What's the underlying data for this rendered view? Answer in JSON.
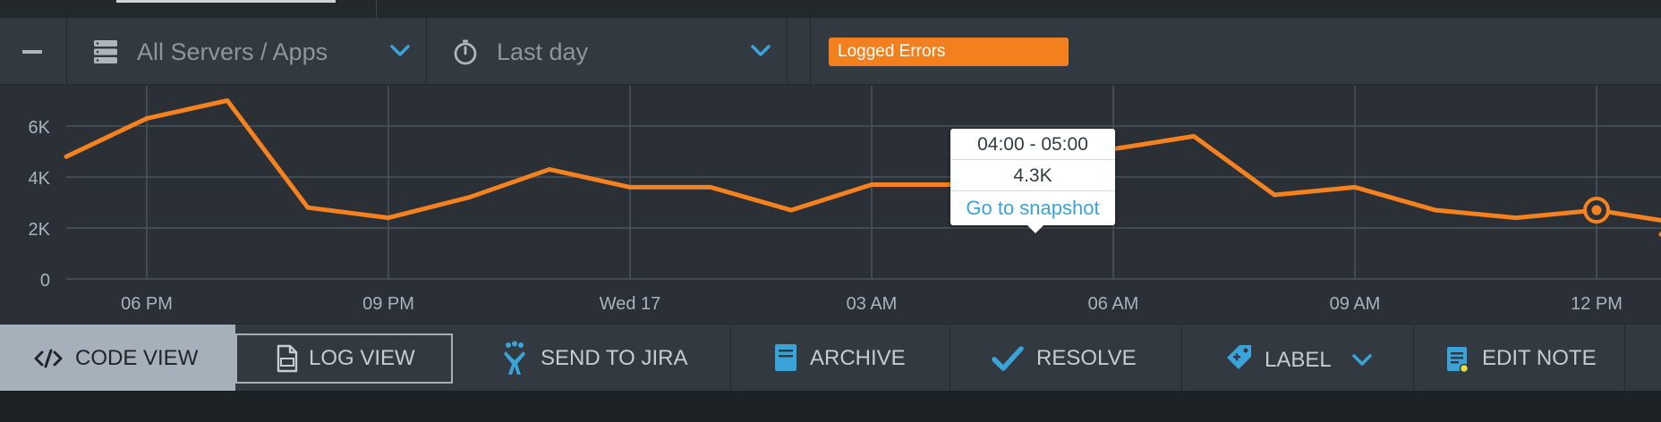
{
  "filters": {
    "source_label": "All Servers / Apps",
    "time_label": "Last day",
    "badge_label": "Logged Errors",
    "icons": [
      "minus-icon",
      "server-stack-icon",
      "stopwatch-icon",
      "chevron-down-icon"
    ]
  },
  "chart_data": {
    "type": "line",
    "title": "",
    "xlabel": "",
    "ylabel": "",
    "x_ticks": [
      "06 PM",
      "09 PM",
      "Wed 17",
      "03 AM",
      "06 AM",
      "09 AM",
      "12 PM"
    ],
    "y_ticks": [
      "0",
      "2K",
      "4K",
      "6K"
    ],
    "ylim": [
      0,
      7000
    ],
    "grid": true,
    "series": [
      {
        "color": "#f5821f",
        "x_hours_from_first_tick": [
          -1,
          0,
          1,
          2,
          3,
          4,
          5,
          6,
          7,
          8,
          9,
          10,
          11,
          12,
          13,
          14,
          15,
          16,
          17,
          18,
          19,
          20,
          21
        ],
        "values": [
          4800,
          6300,
          7000,
          2800,
          2400,
          3200,
          4300,
          3600,
          3600,
          2700,
          3700,
          3700,
          4300,
          5100,
          5600,
          3300,
          3600,
          2700,
          2400,
          2700,
          2200
        ]
      }
    ],
    "highlight": {
      "index": 12,
      "label": "04:00 - 05:00",
      "value_label": "4.3K"
    },
    "ring_marker_index": 19
  },
  "tooltip": {
    "range": "04:00 - 05:00",
    "value": "4.3K",
    "link": "Go to snapshot"
  },
  "toolbar": {
    "code_view": "CODE VIEW",
    "log_view": "LOG VIEW",
    "send_to_jira": "SEND TO JIRA",
    "archive": "ARCHIVE",
    "resolve": "RESOLVE",
    "label": "LABEL",
    "edit_note": "EDIT NOTE"
  },
  "colors": {
    "accent_orange": "#f5821f",
    "link_blue": "#3aa3d8",
    "background": "#2a3036"
  }
}
